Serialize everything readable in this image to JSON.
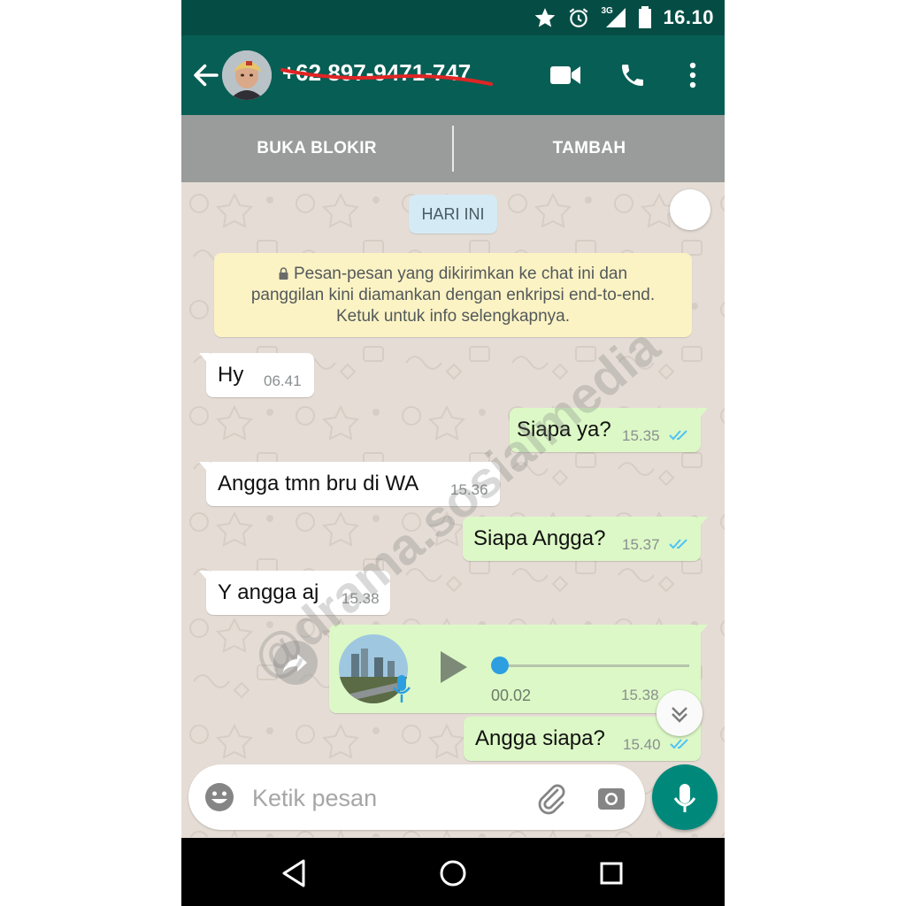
{
  "status_bar": {
    "time": "16.10",
    "network": "3G"
  },
  "header": {
    "contact_name": "+62 897-9471-747"
  },
  "block_bar": {
    "unblock_label": "BUKA BLOKIR",
    "add_label": "TAMBAH"
  },
  "chat": {
    "date_chip": "HARI INI",
    "encryption_notice": {
      "line1": "Pesan-pesan yang dikirimkan ke chat ini dan",
      "line2": "panggilan kini diamankan dengan enkripsi end-to-end.",
      "line3": "Ketuk untuk info selengkapnya."
    },
    "messages": [
      {
        "direction": "in",
        "text": "Hy",
        "time": "06.41"
      },
      {
        "direction": "out",
        "text": "Siapa ya?",
        "time": "15.35",
        "read": true
      },
      {
        "direction": "in",
        "text": "Angga tmn bru di WA",
        "time": "15.36"
      },
      {
        "direction": "out",
        "text": "Siapa Angga?",
        "time": "15.37",
        "read": true
      },
      {
        "direction": "in",
        "text": "Y angga aj",
        "time": "15.38"
      },
      {
        "direction": "out",
        "text": "Angga siapa?",
        "time": "15.40",
        "read": true
      }
    ],
    "voice_note": {
      "direction": "out",
      "duration": "00.02",
      "time": "15.38",
      "progress": 0.0,
      "read": true
    },
    "watermark": "@drama.sosialmedia"
  },
  "composer": {
    "placeholder": "Ketik pesan"
  },
  "colors": {
    "header": "#075e54",
    "status_bar": "#054d44",
    "outgoing_bubble": "#dcf8c6",
    "incoming_bubble": "#ffffff",
    "read_tick": "#4fc3f7",
    "fab": "#00897b"
  },
  "icons": [
    "star-icon",
    "alarm-icon",
    "signal-icon",
    "battery-icon",
    "back-arrow-icon",
    "video-call-icon",
    "phone-call-icon",
    "more-vert-icon",
    "lock-icon",
    "double-tick-icon",
    "play-icon",
    "mic-icon",
    "forward-icon",
    "chevron-double-down-icon",
    "emoji-icon",
    "attachment-icon",
    "camera-icon",
    "back-triangle-icon",
    "home-circle-icon",
    "recents-square-icon"
  ]
}
